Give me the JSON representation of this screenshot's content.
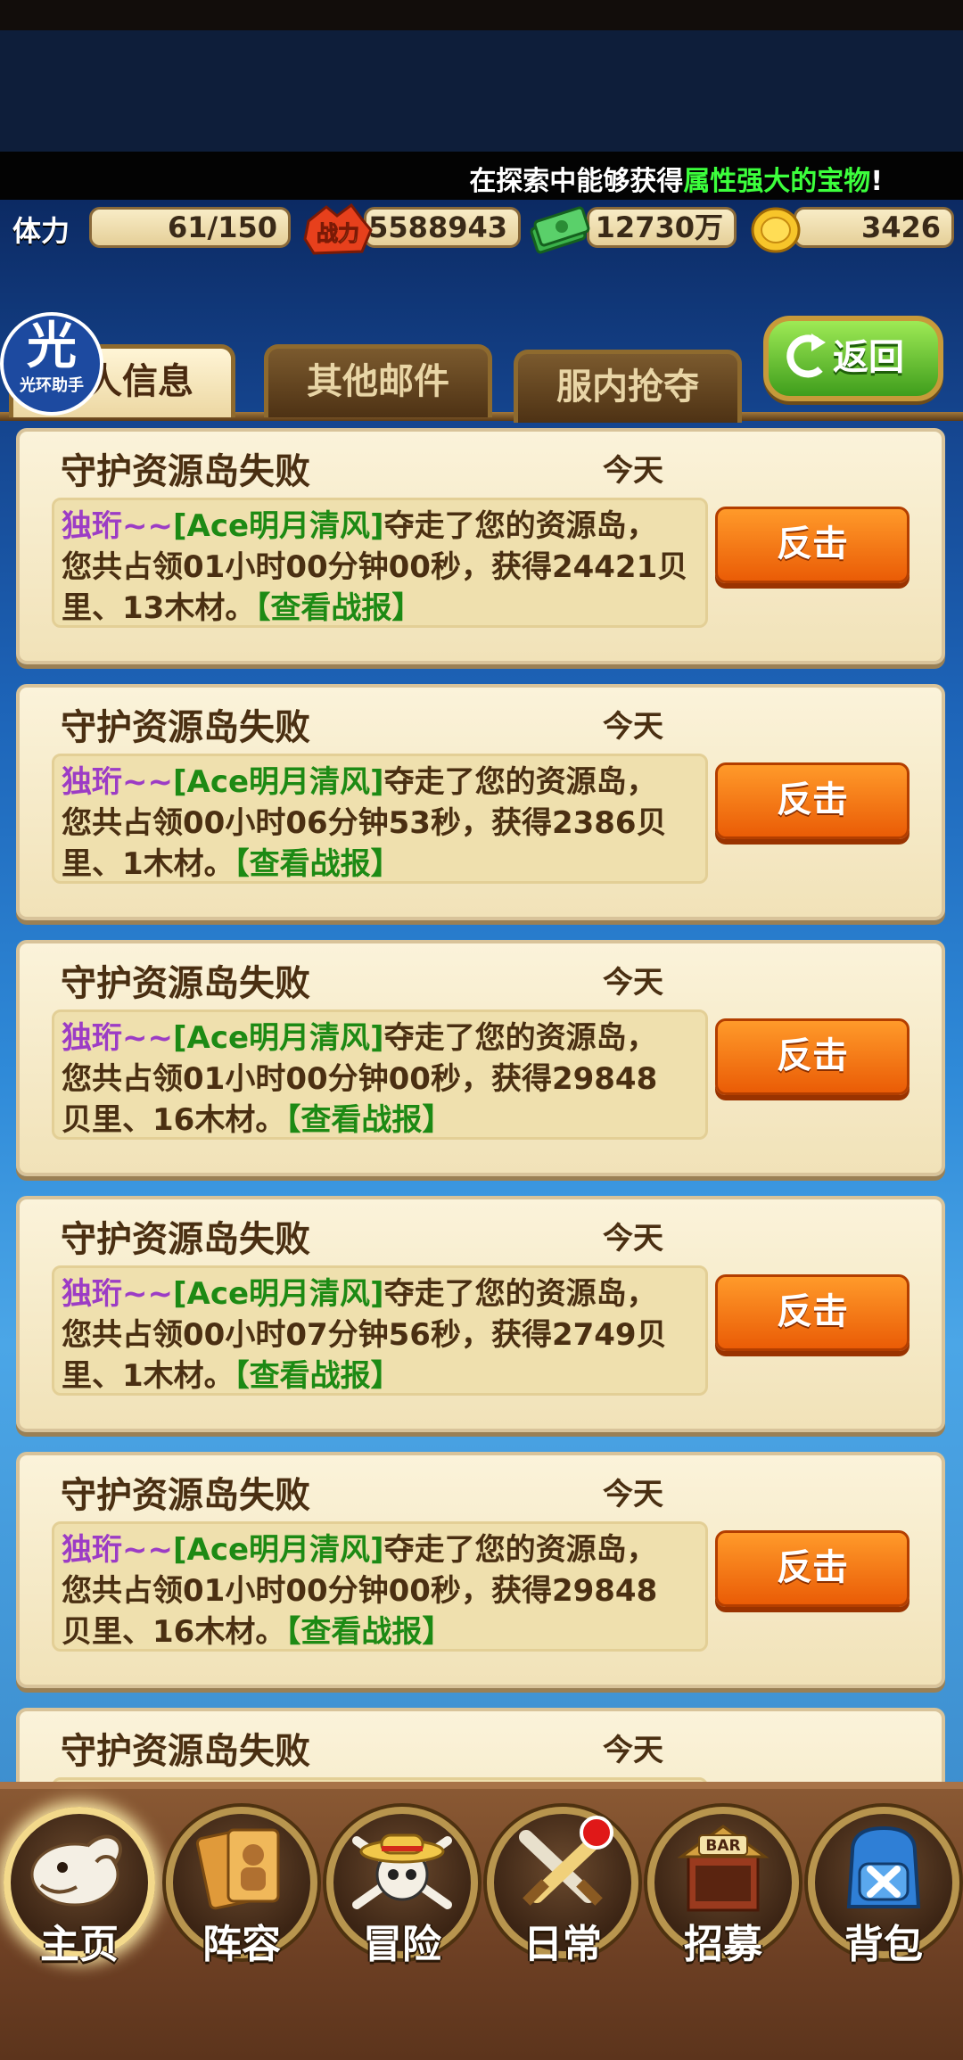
{
  "marquee": {
    "text_prefix": "在探索中能够获得",
    "text_highlight": "属性强大的宝物",
    "text_suffix": "!"
  },
  "resources": {
    "stamina_label": "体力",
    "stamina_value": "61/150",
    "power_icon_label": "战力",
    "power_value": "5588943",
    "cash_value": "12730万",
    "gold_value": "3426"
  },
  "tabs": [
    {
      "label": "个人信息",
      "active": true
    },
    {
      "label": "其他邮件",
      "active": false
    },
    {
      "label": "服内抢夺",
      "active": false
    }
  ],
  "back_button": {
    "label": "返回"
  },
  "watermark": {
    "big": "光",
    "small": "光环助手"
  },
  "mails": [
    {
      "title": "守护资源岛失败",
      "date": "今天",
      "attacker": "独珩~~",
      "guild": "[Ace明月清风]",
      "line1_tail": "夺走了您的资源岛，",
      "line2": "您共占领01小时00分钟00秒，获得24421贝",
      "line3": "里、13木材。",
      "report": "【查看战报】",
      "button": "反击"
    },
    {
      "title": "守护资源岛失败",
      "date": "今天",
      "attacker": "独珩~~",
      "guild": "[Ace明月清风]",
      "line1_tail": "夺走了您的资源岛，",
      "line2": "您共占领00小时06分钟53秒，获得2386贝",
      "line3": "里、1木材。",
      "report": "【查看战报】",
      "button": "反击"
    },
    {
      "title": "守护资源岛失败",
      "date": "今天",
      "attacker": "独珩~~",
      "guild": "[Ace明月清风]",
      "line1_tail": "夺走了您的资源岛，",
      "line2": "您共占领01小时00分钟00秒，获得29848",
      "line3": "贝里、16木材。",
      "report": "【查看战报】",
      "button": "反击"
    },
    {
      "title": "守护资源岛失败",
      "date": "今天",
      "attacker": "独珩~~",
      "guild": "[Ace明月清风]",
      "line1_tail": "夺走了您的资源岛，",
      "line2": "您共占领00小时07分钟56秒，获得2749贝",
      "line3": "里、1木材。",
      "report": "【查看战报】",
      "button": "反击"
    },
    {
      "title": "守护资源岛失败",
      "date": "今天",
      "attacker": "独珩~~",
      "guild": "[Ace明月清风]",
      "line1_tail": "夺走了您的资源岛，",
      "line2": "您共占领01小时00分钟00秒，获得29848",
      "line3": "贝里、16木材。",
      "report": "【查看战报】",
      "button": "反击"
    },
    {
      "title": "守护资源岛失败",
      "date": "今天"
    }
  ],
  "nav": [
    {
      "label": "主页",
      "icon": "merry-goat-icon",
      "active": true
    },
    {
      "label": "阵容",
      "icon": "crew-cards-icon",
      "active": false
    },
    {
      "label": "冒险",
      "icon": "straw-hat-skull-icon",
      "active": false
    },
    {
      "label": "日常",
      "icon": "crossed-swords-icon",
      "active": false,
      "badge": true
    },
    {
      "label": "招募",
      "icon": "bar-tavern-icon",
      "active": false,
      "bar_sign": "BAR"
    },
    {
      "label": "背包",
      "icon": "backpack-icon",
      "active": false
    }
  ]
}
